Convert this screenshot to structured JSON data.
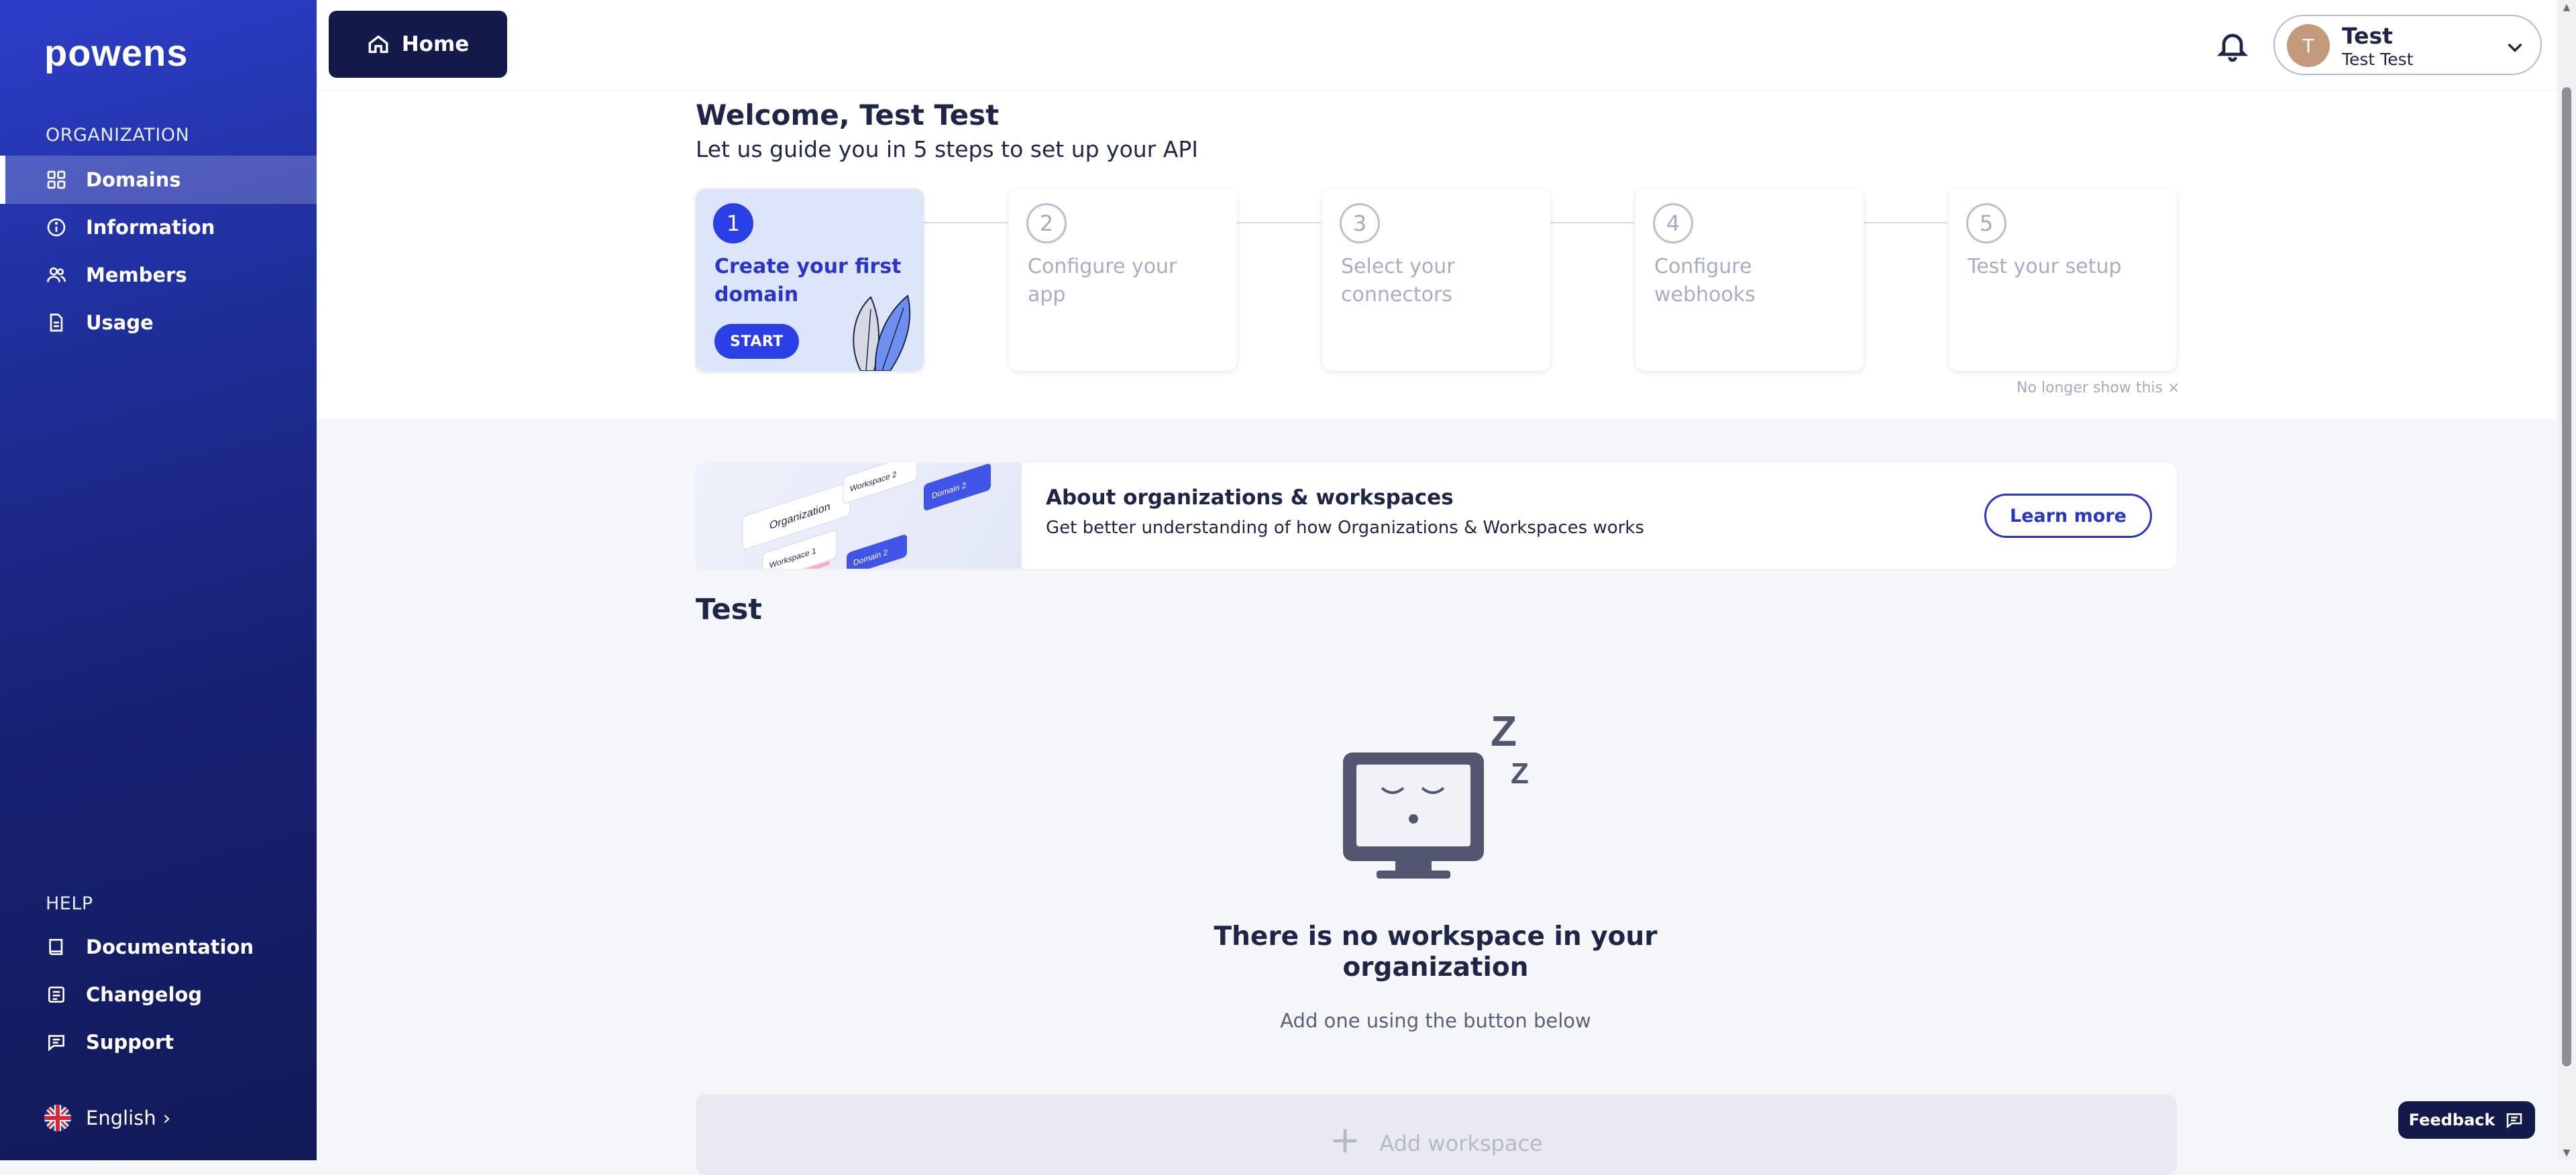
{
  "brand": {
    "logo_text": "powens"
  },
  "sidebar": {
    "org_section": "ORGANIZATION",
    "org_items": [
      {
        "label": "Domains",
        "icon": "grid-icon"
      },
      {
        "label": "Information",
        "icon": "info-icon"
      },
      {
        "label": "Members",
        "icon": "users-icon"
      },
      {
        "label": "Usage",
        "icon": "document-icon"
      }
    ],
    "help_section": "HELP",
    "help_items": [
      {
        "label": "Documentation",
        "icon": "book-icon"
      },
      {
        "label": "Changelog",
        "icon": "changelog-icon"
      },
      {
        "label": "Support",
        "icon": "chat-icon"
      }
    ],
    "language": "English",
    "language_caret": "›"
  },
  "topbar": {
    "home_label": "Home",
    "user": {
      "initial": "T",
      "name": "Test",
      "full_name": "Test Test"
    }
  },
  "welcome": {
    "title": "Welcome, Test Test",
    "subtitle": "Let us guide you in 5 steps to set up your API",
    "steps": [
      {
        "number": "1",
        "label": "Create your first domain",
        "active": true
      },
      {
        "number": "2",
        "label": "Configure your app",
        "active": false
      },
      {
        "number": "3",
        "label": "Select your connectors",
        "active": false
      },
      {
        "number": "4",
        "label": "Configure webhooks",
        "active": false
      },
      {
        "number": "5",
        "label": "Test your setup",
        "active": false
      }
    ],
    "start_label": "START",
    "dismiss_label": "No longer show this ×"
  },
  "banner": {
    "title": "About organizations & workspaces",
    "subtitle": "Get better understanding of how Organizations & Workspaces works",
    "button": "Learn more",
    "art": {
      "org": "Organization",
      "ws1": "Workspace 1",
      "ws2": "Workspace 2",
      "d2": "Domain 2",
      "d1": "Domain 2"
    }
  },
  "organization": {
    "name": "Test",
    "empty_title": "There is no workspace in your organization",
    "empty_subtitle": "Add one using the button below",
    "add_label": "Add workspace",
    "sleep_z1": "Z",
    "sleep_z2": "Z"
  },
  "feedback": {
    "label": "Feedback"
  },
  "colors": {
    "accent": "#2a3fe6",
    "navy": "#131a4a",
    "sidebar_dark": "#121a58"
  }
}
